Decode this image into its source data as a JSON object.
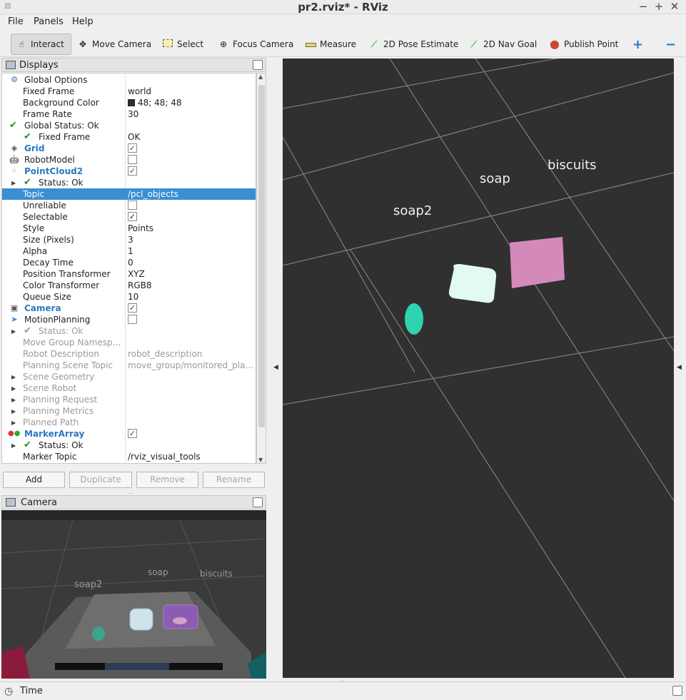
{
  "window": {
    "title": "pr2.rviz* - RViz",
    "app_icon": "rviz-icon"
  },
  "menu": [
    "File",
    "Panels",
    "Help"
  ],
  "toolbar": {
    "tools": [
      {
        "label": "Interact",
        "icon": "cursor-icon"
      },
      {
        "label": "Move Camera",
        "icon": "move-camera-icon"
      },
      {
        "label": "Select",
        "icon": "select-icon"
      },
      {
        "label": "Focus Camera",
        "icon": "crosshair-icon"
      },
      {
        "label": "Measure",
        "icon": "ruler-icon"
      },
      {
        "label": "2D Pose Estimate",
        "icon": "green-arrow-icon"
      },
      {
        "label": "2D Nav Goal",
        "icon": "green-arrow-icon"
      },
      {
        "label": "Publish Point",
        "icon": "map-pin-icon"
      }
    ],
    "add_tool": "+",
    "remove_tool": "−"
  },
  "displays": {
    "title": "Displays",
    "rows": [
      {
        "name": "Global Options",
        "value": ""
      },
      {
        "name": "Fixed Frame",
        "value": "world"
      },
      {
        "name": "Background Color",
        "value": "48; 48; 48"
      },
      {
        "name": "Frame Rate",
        "value": "30"
      },
      {
        "name": "Global Status: Ok",
        "value": ""
      },
      {
        "name": "Fixed Frame",
        "value": "OK"
      },
      {
        "name": "Grid",
        "value": ""
      },
      {
        "name": "RobotModel",
        "value": ""
      },
      {
        "name": "PointCloud2",
        "value": ""
      },
      {
        "name": "Status: Ok",
        "value": ""
      },
      {
        "name": "Topic",
        "value": "/pcl_objects"
      },
      {
        "name": "Unreliable",
        "value": ""
      },
      {
        "name": "Selectable",
        "value": ""
      },
      {
        "name": "Style",
        "value": "Points"
      },
      {
        "name": "Size (Pixels)",
        "value": "3"
      },
      {
        "name": "Alpha",
        "value": "1"
      },
      {
        "name": "Decay Time",
        "value": "0"
      },
      {
        "name": "Position Transformer",
        "value": "XYZ"
      },
      {
        "name": "Color Transformer",
        "value": "RGB8"
      },
      {
        "name": "Queue Size",
        "value": "10"
      },
      {
        "name": "Camera",
        "value": ""
      },
      {
        "name": "MotionPlanning",
        "value": ""
      },
      {
        "name": "Status: Ok",
        "value": ""
      },
      {
        "name": "Move Group Namesp...",
        "value": ""
      },
      {
        "name": "Robot Description",
        "value": "robot_description"
      },
      {
        "name": "Planning Scene Topic",
        "value": "move_group/monitored_pla..."
      },
      {
        "name": "Scene Geometry",
        "value": ""
      },
      {
        "name": "Scene Robot",
        "value": ""
      },
      {
        "name": "Planning Request",
        "value": ""
      },
      {
        "name": "Planning Metrics",
        "value": ""
      },
      {
        "name": "Planned Path",
        "value": ""
      },
      {
        "name": "MarkerArray",
        "value": ""
      },
      {
        "name": "Status: Ok",
        "value": ""
      },
      {
        "name": "Marker Topic",
        "value": "/rviz_visual_tools"
      }
    ],
    "checked": {
      "grid": true,
      "robotmodel": false,
      "pointcloud2": true,
      "unreliable": false,
      "selectable": true,
      "camera": true,
      "motionplanning": false,
      "markerarray": true
    }
  },
  "buttons": {
    "add": "Add",
    "duplicate": "Duplicate",
    "remove": "Remove",
    "rename": "Rename"
  },
  "camera_panel": {
    "title": "Camera",
    "labels": [
      "soap2",
      "soap",
      "biscuits"
    ]
  },
  "view3d": {
    "background": "#303030",
    "labels": [
      "soap",
      "biscuits",
      "soap2"
    ],
    "cloud_colors": {
      "soap2": "#2ed3b0",
      "soap": "#e3faf0",
      "biscuits": "#d489bb"
    }
  },
  "status": {
    "time_label": "Time"
  }
}
